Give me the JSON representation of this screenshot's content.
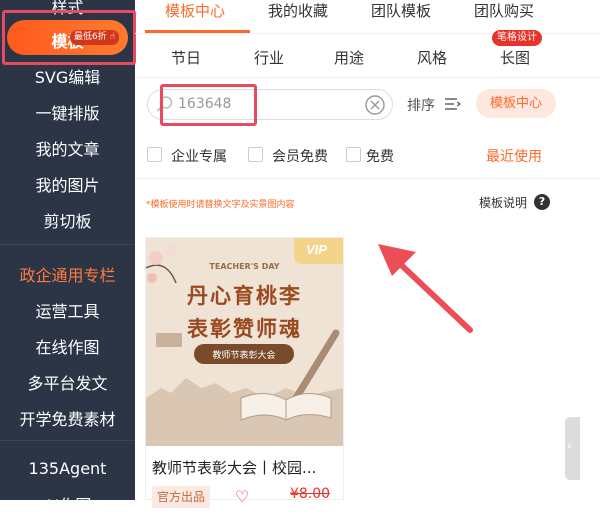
{
  "sidebar": {
    "items": [
      {
        "label": "样式"
      },
      {
        "label": "模板",
        "badge": "最低6折"
      },
      {
        "label": "SVG编辑"
      },
      {
        "label": "一键排版"
      },
      {
        "label": "我的文章"
      },
      {
        "label": "我的图片"
      },
      {
        "label": "剪切板"
      },
      {
        "label": "政企通用专栏"
      },
      {
        "label": "运营工具"
      },
      {
        "label": "在线作图"
      },
      {
        "label": "多平台发文"
      },
      {
        "label": "开学免费素材"
      },
      {
        "label": "135Agent"
      },
      {
        "label": "AI作图"
      }
    ],
    "accent_color": "#ff6a2a"
  },
  "top_tabs": [
    {
      "label": "模板中心"
    },
    {
      "label": "我的收藏"
    },
    {
      "label": "团队模板"
    },
    {
      "label": "团队购买"
    }
  ],
  "category_tabs": [
    {
      "label": "节日"
    },
    {
      "label": "行业"
    },
    {
      "label": "用途"
    },
    {
      "label": "风格"
    },
    {
      "label": "长图",
      "badge": "笔格设计"
    }
  ],
  "search": {
    "value": "163648",
    "sort_label": "排序",
    "template_center_button": "模板中心"
  },
  "filters": {
    "options": [
      {
        "label": "企业专属"
      },
      {
        "label": "会员免费"
      },
      {
        "label": "免费"
      }
    ],
    "recent_label": "最近使用"
  },
  "notice": "*模板使用时请替换文字及实景图内容",
  "explain_label": "模板说明",
  "card": {
    "vip_badge": "VIP",
    "poster_subtitle": "TEACHER'S DAY",
    "poster_line1": "丹心育桃李",
    "poster_line2": "表彰赞师魂",
    "poster_banner": "教师节表彰大会",
    "title": "教师节表彰大会丨校园...",
    "tag": "官方出品",
    "price": "¥8.00"
  }
}
